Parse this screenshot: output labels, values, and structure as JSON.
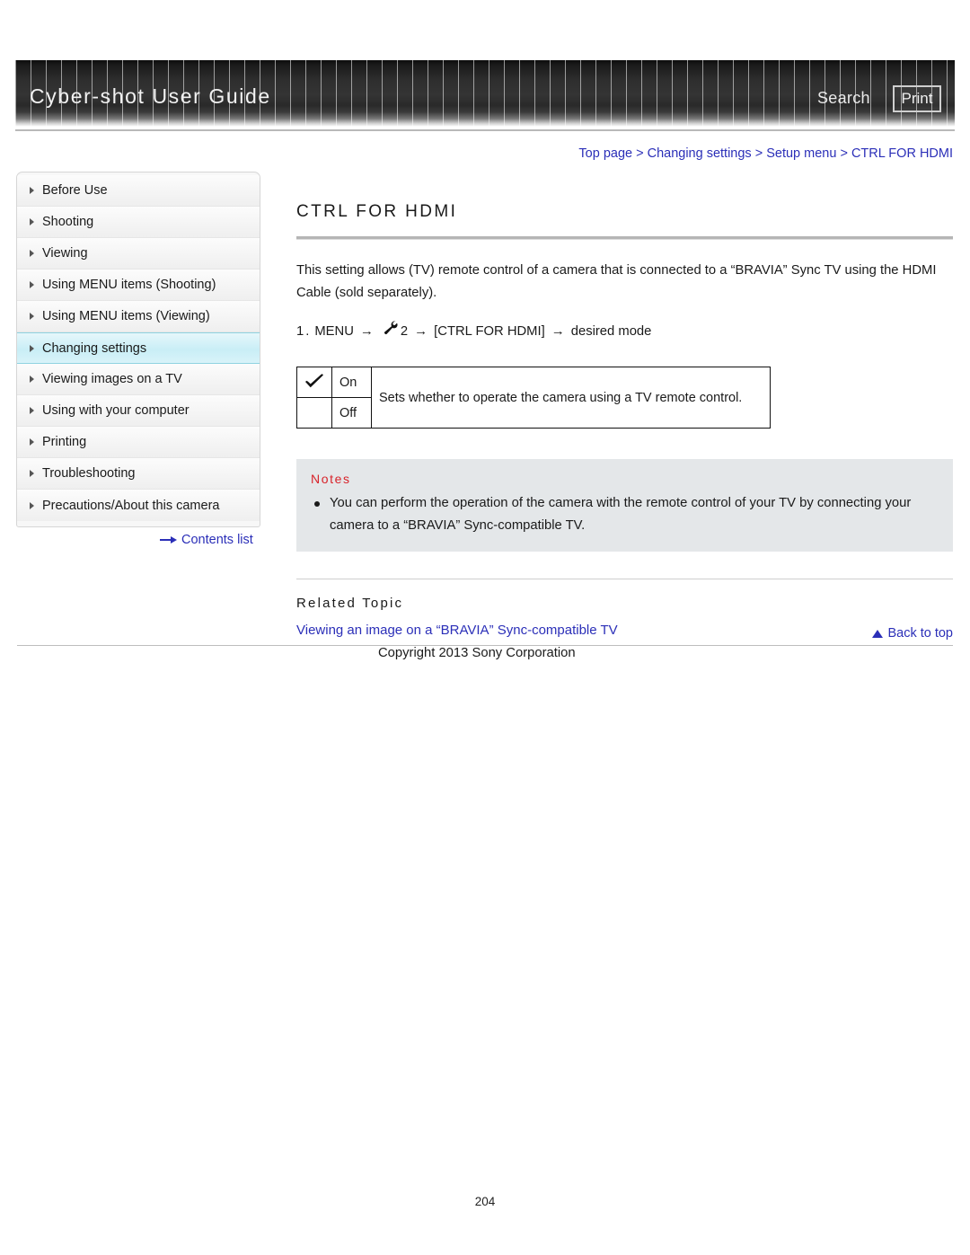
{
  "header": {
    "title": "Cyber-shot User Guide",
    "search_label": "Search",
    "print_label": "Print"
  },
  "breadcrumb": {
    "separator": ">",
    "items": [
      {
        "label": "Top page"
      },
      {
        "label": "Changing settings"
      },
      {
        "label": "Setup menu"
      },
      {
        "label": "CTRL FOR HDMI"
      }
    ]
  },
  "sidebar": {
    "items": [
      {
        "label": "Before Use",
        "active": false
      },
      {
        "label": "Shooting",
        "active": false
      },
      {
        "label": "Viewing",
        "active": false
      },
      {
        "label": "Using MENU items (Shooting)",
        "active": false
      },
      {
        "label": "Using MENU items (Viewing)",
        "active": false
      },
      {
        "label": "Changing settings",
        "active": true
      },
      {
        "label": "Viewing images on a TV",
        "active": false
      },
      {
        "label": "Using with your computer",
        "active": false
      },
      {
        "label": "Printing",
        "active": false
      },
      {
        "label": "Troubleshooting",
        "active": false
      },
      {
        "label": "Precautions/About this camera",
        "active": false
      }
    ],
    "contents_list_label": "Contents list",
    "contents_list_icon": "arrow-right-icon"
  },
  "main": {
    "page_title": "CTRL FOR HDMI",
    "intro": "This setting allows (TV) remote control of a camera that is connected to a “BRAVIA” Sync TV using the HDMI Cable (sold separately).",
    "step": {
      "number": "1.",
      "menu_label": "MENU",
      "arrow": "→",
      "wrench_icon": "wrench-icon",
      "tab_number": "2",
      "bracket_item": "[CTRL FOR HDMI]",
      "final": "desired mode"
    },
    "options_table": {
      "rows": [
        {
          "check": "✓",
          "checked": true,
          "label": "On"
        },
        {
          "check": "",
          "checked": false,
          "label": "Off"
        }
      ],
      "description": "Sets whether to operate the camera using a TV remote control."
    },
    "notes": {
      "heading": "Notes",
      "items": [
        "You can perform the operation of the camera with the remote control of your TV by connecting your camera to a “BRAVIA” Sync-compatible TV."
      ]
    },
    "related": {
      "heading": "Related Topic",
      "links": [
        "Viewing an image on a “BRAVIA” Sync-compatible TV"
      ]
    }
  },
  "footer": {
    "back_to_top_label": "Back to top",
    "back_to_top_icon": "triangle-up-icon",
    "copyright": "Copyright 2013 Sony Corporation",
    "page_number": "204"
  },
  "colors": {
    "link": "#2b2fb8",
    "notes_heading": "#d8232a",
    "notes_bg": "#e4e7e9",
    "sidebar_active": "#c9eef6"
  }
}
